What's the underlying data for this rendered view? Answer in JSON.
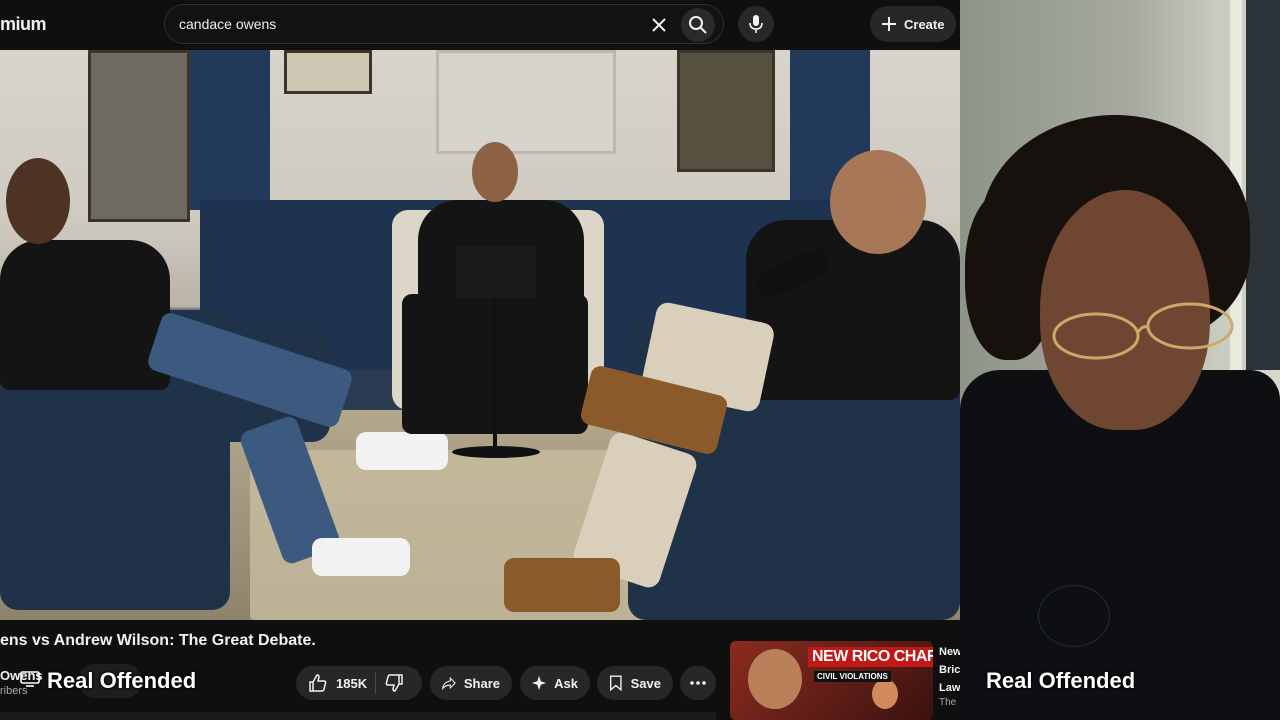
{
  "topbar": {
    "logo_text": "mium",
    "search_value": "candace owens",
    "create_label": "Create",
    "icons": [
      "close-icon",
      "search-icon",
      "microphone-icon",
      "plus-icon"
    ]
  },
  "video": {
    "title": "ens vs Andrew Wilson: The Great Debate.",
    "channel": "Owens",
    "subscribers": "ribers"
  },
  "actions": {
    "likes": "185K",
    "share": "Share",
    "ask": "Ask",
    "save": "Save"
  },
  "recommended": {
    "thumb_headline": "NEW RICO CHARGES!",
    "thumb_subline": "CIVIL VIOLATIONS",
    "title_lines": [
      "New",
      "Bric",
      "Law"
    ],
    "channel": "The"
  },
  "overlay": {
    "name_left": "Real Offended",
    "name_right": "Real Offended"
  },
  "colors": {
    "background": "#0f0f0f",
    "pill": "#272727",
    "thumb_red": "#c21818"
  }
}
